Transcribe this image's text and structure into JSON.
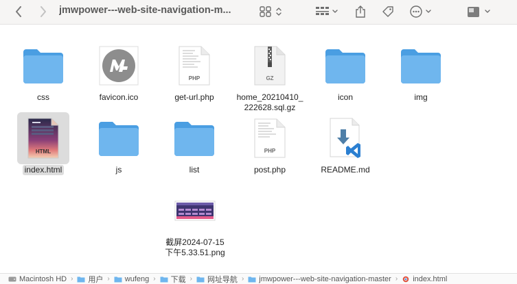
{
  "window": {
    "title": "jmwpower---web-site-navigation-m..."
  },
  "colors": {
    "folder": "#6fb6ee",
    "folder_dark": "#4a9ee2",
    "selection": "#dcdcdc",
    "vscode_blue": "#2b7fd1"
  },
  "toolbar": {
    "back_icon": "chevron-left-icon",
    "forward_icon": "chevron-right-icon",
    "view_icon": "grid-view-icon",
    "group_icon": "group-icon",
    "share_icon": "share-icon",
    "tag_icon": "tag-icon",
    "more_icon": "ellipsis-circle-icon",
    "preview_icon": "preview-pane-icon"
  },
  "files": [
    {
      "name": "css",
      "kind": "folder"
    },
    {
      "name": "favicon.ico",
      "kind": "favicon"
    },
    {
      "name": "get-url.php",
      "kind": "php",
      "badge": "PHP"
    },
    {
      "name": "home_20210410_\n222628.sql.gz",
      "kind": "gz",
      "badge": "GZ"
    },
    {
      "name": "icon",
      "kind": "folder"
    },
    {
      "name": "img",
      "kind": "folder"
    },
    {
      "name": "index.html",
      "kind": "html",
      "badge": "HTML",
      "selected": true
    },
    {
      "name": "js",
      "kind": "folder"
    },
    {
      "name": "list",
      "kind": "folder"
    },
    {
      "name": "post.php",
      "kind": "php",
      "badge": "PHP"
    },
    {
      "name": "README.md",
      "kind": "md"
    },
    {
      "name": "截屏2024-07-15\n下午5.33.51.png",
      "kind": "png"
    }
  ],
  "pathbar": {
    "crumbs": [
      "Macintosh HD",
      "用户",
      "wufeng",
      "下载",
      "网址导航",
      "jmwpower---web-site-navigation-master",
      "index.html"
    ]
  }
}
